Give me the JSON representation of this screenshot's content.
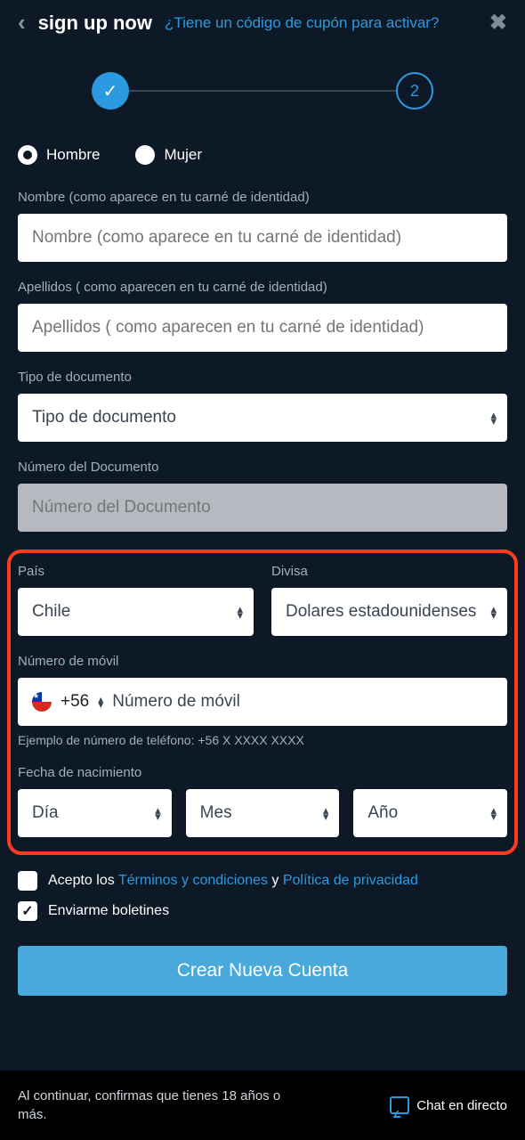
{
  "header": {
    "title": "sign up now",
    "coupon_link": "¿Tiene un código de cupón para activar?"
  },
  "stepper": {
    "step2_label": "2"
  },
  "gender": {
    "male": "Hombre",
    "female": "Mujer"
  },
  "name": {
    "label": "Nombre (como aparece en tu carné de identidad)",
    "placeholder": "Nombre (como aparece en tu carné de identidad)"
  },
  "surname": {
    "label": "Apellidos ( como aparecen en tu carné de identidad)",
    "placeholder": "Apellidos ( como aparecen en tu carné de identidad)"
  },
  "doc_type": {
    "label": "Tipo de documento",
    "placeholder": "Tipo de documento"
  },
  "doc_number": {
    "label": "Número del Documento",
    "placeholder": "Número del Documento"
  },
  "country": {
    "label": "País",
    "value": "Chile"
  },
  "currency": {
    "label": "Divisa",
    "value": "Dolares estadounidenses"
  },
  "mobile": {
    "label": "Número de móvil",
    "dial_code": "+56",
    "placeholder": "Número de móvil",
    "hint": "Ejemplo de número de teléfono: +56 X XXXX XXXX"
  },
  "dob": {
    "label": "Fecha de nacimiento",
    "day": "Día",
    "month": "Mes",
    "year": "Año"
  },
  "terms": {
    "prefix": "Acepto los ",
    "link1": "Términos y condiciones",
    "conj": " y ",
    "link2": "Política de privacidad"
  },
  "newsletter": "Enviarme boletines",
  "submit": "Crear Nueva Cuenta",
  "footer": {
    "age_text": "Al continuar, confirmas que tienes 18 años o más.",
    "chat": "Chat en directo"
  }
}
